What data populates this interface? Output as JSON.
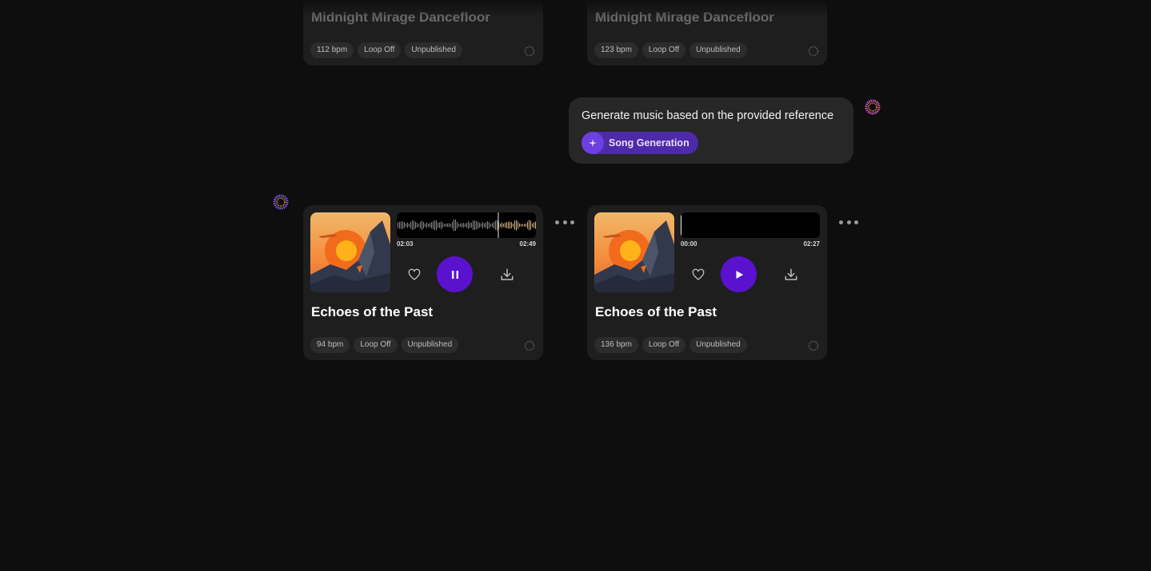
{
  "top_cards": [
    {
      "title": "Midnight Mirage Dancefloor",
      "chips": [
        "112 bpm",
        "Loop Off",
        "Unpublished"
      ]
    },
    {
      "title": "Midnight Mirage Dancefloor",
      "chips": [
        "123 bpm",
        "Loop Off",
        "Unpublished"
      ]
    }
  ],
  "prompt": {
    "text": "Generate music based on the provided reference",
    "tag_label": "Song Generation",
    "tag_icon": "sparkle-icon"
  },
  "songs": [
    {
      "title": "Echoes of the Past",
      "current_time": "02:03",
      "duration": "02:49",
      "progress": 0.727,
      "state": "playing",
      "chips": [
        "94 bpm",
        "Loop Off",
        "Unpublished"
      ]
    },
    {
      "title": "Echoes of the Past",
      "current_time": "00:00",
      "duration": "02:27",
      "progress": 0.0,
      "state": "paused",
      "chips": [
        "136 bpm",
        "Loop Off",
        "Unpublished"
      ]
    }
  ],
  "colors": {
    "accent": "#5b12cf",
    "tag": "#4d2aa8",
    "background": "#0e0e0e",
    "card": "#1e1e1e"
  }
}
